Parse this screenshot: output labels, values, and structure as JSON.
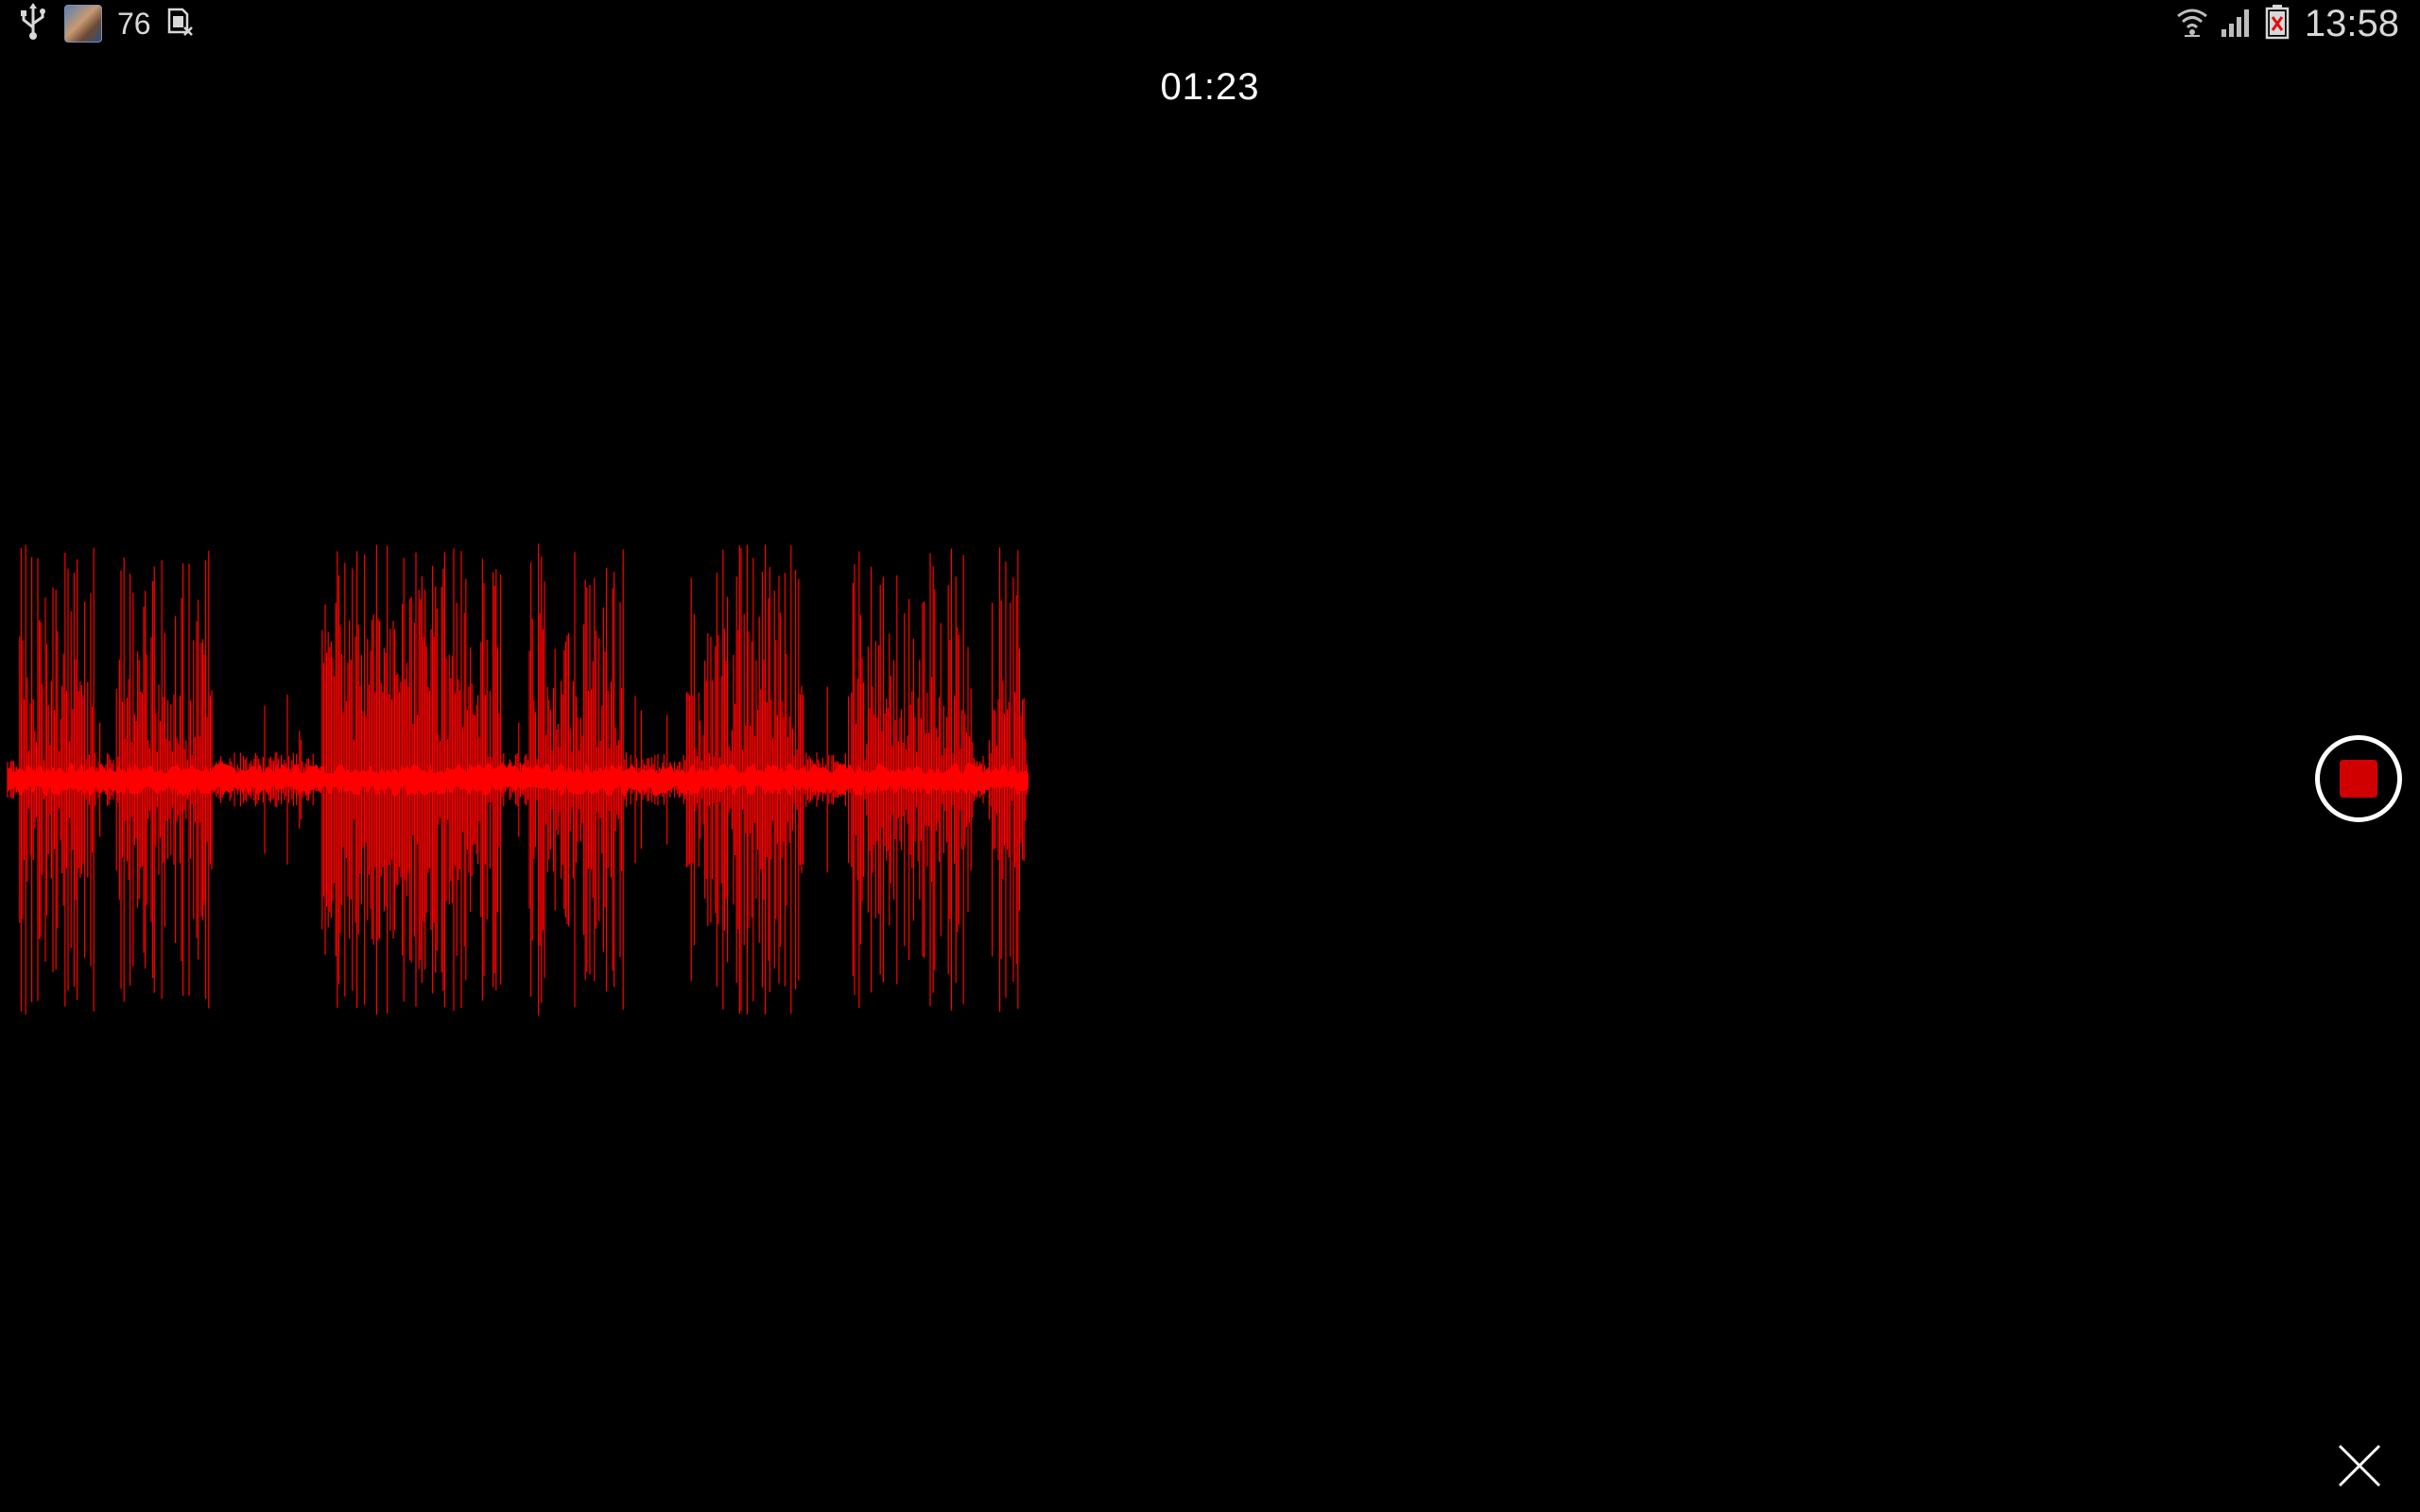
{
  "status_bar": {
    "notification_count": "76",
    "clock": "13:58",
    "icons": [
      "usb-icon",
      "app-avatar-icon",
      "sim-card-icon",
      "wifi-icon",
      "signal-icon",
      "battery-icon"
    ]
  },
  "recorder": {
    "elapsed_time": "01:23",
    "waveform_color": "#ff0000",
    "stop_button_color": "#d10000",
    "state": "recording"
  },
  "controls": {
    "stop_icon": "stop-record-icon",
    "close_icon": "close-icon"
  }
}
